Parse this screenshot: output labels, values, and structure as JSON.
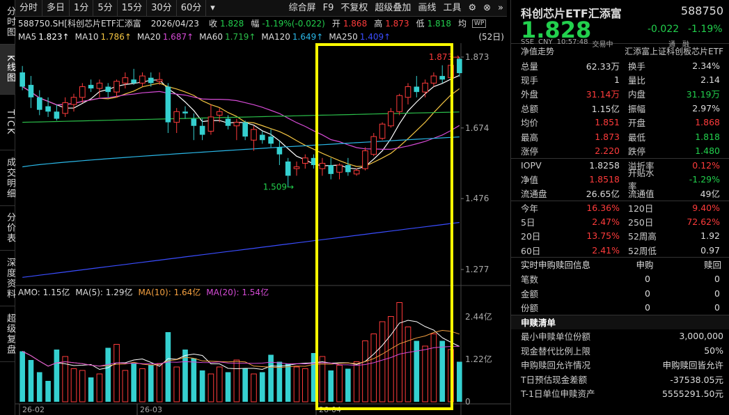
{
  "left_tabs": [
    "分时图",
    "K线图",
    "TICK",
    "成交明细",
    "分价表",
    "深度资料",
    "超级复盘"
  ],
  "toolbar": {
    "periods": [
      "分时",
      "多日",
      "1分",
      "5分",
      "15分",
      "30分",
      "60分"
    ],
    "right": [
      "综合屏",
      "F9",
      "不复权",
      "超级叠加",
      "画线",
      "工具"
    ]
  },
  "info": {
    "code_name": "588750.SH[科创芯片ETF汇添富",
    "date": "2026/04/23",
    "close_label": "收",
    "close": "1.828",
    "change_label": "幅",
    "change": "-1.19%(-0.022)",
    "open_label": "开",
    "open": "1.868",
    "high_label": "高",
    "high": "1.873",
    "low_label": "低",
    "low": "1.818",
    "avg_label": "均"
  },
  "ma": [
    {
      "label": "MA5",
      "value": "1.823↑",
      "color": "#ffffff"
    },
    {
      "label": "MA10",
      "value": "1.786↑",
      "color": "#f4c542"
    },
    {
      "label": "MA20",
      "value": "1.687↑",
      "color": "#d64bd6"
    },
    {
      "label": "MA60",
      "value": "1.719↑",
      "color": "#2bbf4a"
    },
    {
      "label": "MA120",
      "value": "1.649↑",
      "color": "#2ab8e8"
    },
    {
      "label": "MA250",
      "value": "1.409↑",
      "color": "#3a4dff"
    }
  ],
  "period_badge": "(52日)",
  "price_axis": [
    "1.873",
    "1.674",
    "1.476",
    "1.277"
  ],
  "annotations": {
    "high": "1.873",
    "low": "1.509"
  },
  "volume": {
    "amo": "AMO: 1.15亿",
    "ma5": "MA(5): 1.29亿",
    "ma10": "MA(10): 1.64亿",
    "ma20": "MA(20): 1.54亿",
    "axis": [
      "2.44亿",
      "1.22亿",
      "0"
    ]
  },
  "x_labels": [
    "26-02",
    "26-03",
    "26-04"
  ],
  "chart_data": {
    "type": "candlestick",
    "dates_shown": [
      "26-02",
      "26-03",
      "26-04"
    ],
    "candles": [
      {
        "o": 1.83,
        "h": 1.848,
        "l": 1.78,
        "c": 1.79
      },
      {
        "o": 1.795,
        "h": 1.82,
        "l": 1.73,
        "c": 1.76
      },
      {
        "o": 1.76,
        "h": 1.78,
        "l": 1.71,
        "c": 1.725
      },
      {
        "o": 1.735,
        "h": 1.76,
        "l": 1.705,
        "c": 1.72
      },
      {
        "o": 1.72,
        "h": 1.74,
        "l": 1.695,
        "c": 1.7
      },
      {
        "o": 1.715,
        "h": 1.76,
        "l": 1.705,
        "c": 1.745
      },
      {
        "o": 1.74,
        "h": 1.77,
        "l": 1.72,
        "c": 1.76
      },
      {
        "o": 1.76,
        "h": 1.8,
        "l": 1.745,
        "c": 1.79
      },
      {
        "o": 1.795,
        "h": 1.81,
        "l": 1.775,
        "c": 1.785
      },
      {
        "o": 1.785,
        "h": 1.81,
        "l": 1.76,
        "c": 1.8
      },
      {
        "o": 1.79,
        "h": 1.8,
        "l": 1.76,
        "c": 1.775
      },
      {
        "o": 1.775,
        "h": 1.81,
        "l": 1.76,
        "c": 1.805
      },
      {
        "o": 1.8,
        "h": 1.83,
        "l": 1.785,
        "c": 1.815
      },
      {
        "o": 1.81,
        "h": 1.84,
        "l": 1.795,
        "c": 1.8
      },
      {
        "o": 1.8,
        "h": 1.83,
        "l": 1.79,
        "c": 1.82
      },
      {
        "o": 1.815,
        "h": 1.83,
        "l": 1.79,
        "c": 1.8
      },
      {
        "o": 1.805,
        "h": 1.83,
        "l": 1.795,
        "c": 1.81
      },
      {
        "o": 1.79,
        "h": 1.8,
        "l": 1.66,
        "c": 1.69
      },
      {
        "o": 1.69,
        "h": 1.73,
        "l": 1.66,
        "c": 1.72
      },
      {
        "o": 1.72,
        "h": 1.735,
        "l": 1.7,
        "c": 1.715
      },
      {
        "o": 1.7,
        "h": 1.715,
        "l": 1.64,
        "c": 1.68
      },
      {
        "o": 1.68,
        "h": 1.7,
        "l": 1.64,
        "c": 1.655
      },
      {
        "o": 1.665,
        "h": 1.74,
        "l": 1.655,
        "c": 1.705
      },
      {
        "o": 1.71,
        "h": 1.73,
        "l": 1.69,
        "c": 1.72
      },
      {
        "o": 1.7,
        "h": 1.71,
        "l": 1.67,
        "c": 1.68
      },
      {
        "o": 1.68,
        "h": 1.7,
        "l": 1.64,
        "c": 1.69
      },
      {
        "o": 1.69,
        "h": 1.695,
        "l": 1.64,
        "c": 1.65
      },
      {
        "o": 1.64,
        "h": 1.68,
        "l": 1.61,
        "c": 1.67
      },
      {
        "o": 1.655,
        "h": 1.665,
        "l": 1.63,
        "c": 1.64
      },
      {
        "o": 1.65,
        "h": 1.67,
        "l": 1.62,
        "c": 1.63
      },
      {
        "o": 1.62,
        "h": 1.64,
        "l": 1.57,
        "c": 1.6
      },
      {
        "o": 1.58,
        "h": 1.59,
        "l": 1.509,
        "c": 1.54
      },
      {
        "o": 1.56,
        "h": 1.58,
        "l": 1.54,
        "c": 1.565
      },
      {
        "o": 1.575,
        "h": 1.6,
        "l": 1.56,
        "c": 1.59
      },
      {
        "o": 1.59,
        "h": 1.6,
        "l": 1.56,
        "c": 1.57
      },
      {
        "o": 1.56,
        "h": 1.59,
        "l": 1.54,
        "c": 1.575
      },
      {
        "o": 1.57,
        "h": 1.59,
        "l": 1.53,
        "c": 1.545
      },
      {
        "o": 1.55,
        "h": 1.575,
        "l": 1.53,
        "c": 1.57
      },
      {
        "o": 1.57,
        "h": 1.59,
        "l": 1.54,
        "c": 1.55
      },
      {
        "o": 1.545,
        "h": 1.56,
        "l": 1.54,
        "c": 1.555
      },
      {
        "o": 1.56,
        "h": 1.62,
        "l": 1.555,
        "c": 1.61
      },
      {
        "o": 1.6,
        "h": 1.66,
        "l": 1.595,
        "c": 1.65
      },
      {
        "o": 1.645,
        "h": 1.69,
        "l": 1.64,
        "c": 1.685
      },
      {
        "o": 1.68,
        "h": 1.73,
        "l": 1.675,
        "c": 1.72
      },
      {
        "o": 1.72,
        "h": 1.77,
        "l": 1.71,
        "c": 1.765
      },
      {
        "o": 1.76,
        "h": 1.8,
        "l": 1.74,
        "c": 1.79
      },
      {
        "o": 1.79,
        "h": 1.82,
        "l": 1.76,
        "c": 1.775
      },
      {
        "o": 1.775,
        "h": 1.81,
        "l": 1.76,
        "c": 1.8
      },
      {
        "o": 1.8,
        "h": 1.83,
        "l": 1.79,
        "c": 1.82
      },
      {
        "o": 1.82,
        "h": 1.85,
        "l": 1.8,
        "c": 1.81
      },
      {
        "o": 1.815,
        "h": 1.86,
        "l": 1.805,
        "c": 1.85
      },
      {
        "o": 1.868,
        "h": 1.873,
        "l": 1.818,
        "c": 1.828
      }
    ],
    "volumes": [
      1.45,
      1.2,
      0.85,
      0.6,
      1.5,
      1.3,
      0.95,
      0.9,
      0.7,
      0.8,
      1.55,
      1.65,
      0.9,
      1.1,
      0.95,
      1.05,
      1.1,
      2.0,
      1.0,
      1.5,
      1.25,
      0.9,
      0.8,
      1.0,
      0.85,
      1.2,
      0.95,
      0.8,
      0.85,
      1.35,
      1.15,
      1.1,
      1.0,
      0.95,
      1.4,
      1.3,
      0.9,
      1.05,
      0.95,
      1.15,
      1.75,
      1.95,
      2.3,
      2.45,
      2.85,
      2.15,
      1.75,
      1.6,
      1.95,
      1.75,
      1.5,
      1.15
    ]
  },
  "quote": {
    "name": "科创芯片ETF汇添富",
    "code": "588750",
    "price": "1.828",
    "change": "-0.022",
    "change_pct": "-1.19%",
    "sub": [
      "SSE",
      "CNY",
      "10:57:48",
      "交易中"
    ],
    "icons_text": [
      "通",
      "融"
    ],
    "nav_title": "净值走势",
    "nav_name": "汇添富上证科创板芯片ETF",
    "rows": [
      [
        "总量",
        "62.33万",
        "换手",
        "2.34%"
      ],
      [
        "现手",
        "1",
        "量比",
        "2.14"
      ],
      [
        "外盘",
        "31.14万",
        "内盘",
        "31.19万"
      ],
      [
        "总额",
        "1.15亿",
        "振幅",
        "2.97%"
      ],
      [
        "均价",
        "1.851",
        "开盘",
        "1.868"
      ],
      [
        "最高",
        "1.873",
        "最低",
        "1.818"
      ],
      [
        "涨停",
        "2.220",
        "跌停",
        "1.480"
      ],
      [
        "IOPV",
        "1.8258",
        "溢折率",
        "0.12%"
      ],
      [
        "净值",
        "1.8518",
        "升贴水率",
        "-1.29%"
      ],
      [
        "流通盘",
        "26.65亿",
        "流通值",
        "49亿"
      ],
      [
        "今年",
        "16.36%",
        "120日",
        "9.40%"
      ],
      [
        "5日",
        "2.47%",
        "250日",
        "72.62%"
      ],
      [
        "20日",
        "13.75%",
        "52周高",
        "1.92"
      ],
      [
        "60日",
        "2.41%",
        "52周低",
        "0.97"
      ]
    ],
    "subscribe_title": "实时申购赎回信息",
    "subscribe_cols": [
      "申购",
      "赎回"
    ],
    "subscribe_rows": [
      [
        "笔数",
        "0",
        "0"
      ],
      [
        "金额",
        "0",
        "0"
      ],
      [
        "份额",
        "0",
        "0"
      ]
    ],
    "list_title": "申赎清单",
    "list_rows": [
      [
        "最小申赎单位份额",
        "3,000,000"
      ],
      [
        "现金替代比例上限",
        "50%"
      ],
      [
        "申购赎回允许情况",
        "申购赎回皆允许"
      ],
      [
        "T日预估现金差额",
        "-37538.05元"
      ],
      [
        "T-1日单位申赎资产",
        "5555291.50元"
      ]
    ]
  }
}
